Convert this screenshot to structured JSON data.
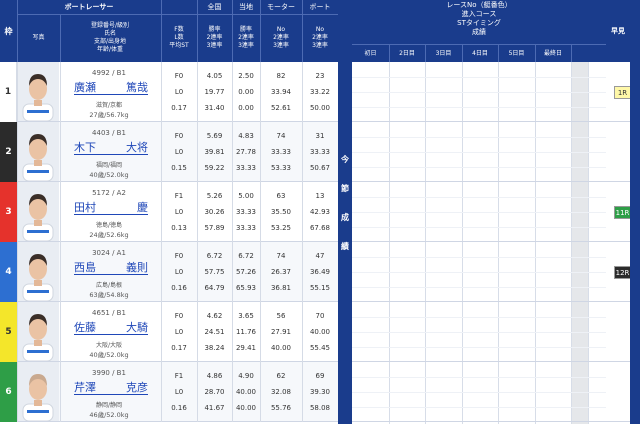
{
  "header": {
    "waku": "枠",
    "boat_racer": "ボートレーサー",
    "photo": "写真",
    "racer_info": [
      "登録番号/級別",
      "氏名",
      "支部/出身地",
      "年齢/体重"
    ],
    "f_l_st": [
      "F数",
      "L数",
      "平均ST"
    ],
    "nationwide": "全国",
    "local": "当地",
    "motor": "モーター",
    "boat": "ボート",
    "rate_labels": [
      "勝率",
      "2連率",
      "3連率"
    ],
    "no_labels": [
      "No",
      "2連率",
      "3連率"
    ],
    "race_info": [
      "レースNo（艇番色）",
      "進入コース",
      "STタイミング",
      "成績"
    ],
    "days": [
      "初日",
      "2日目",
      "3日目",
      "4日目",
      "5日目",
      "最終日"
    ],
    "tenji": "早見",
    "konsetsu": [
      "今",
      "節",
      "成",
      "績"
    ]
  },
  "colors": {
    "header_bg": "#1a3c8c",
    "name_link": "#1f47b8",
    "waku": [
      "#ffffff",
      "#2b2b2b",
      "#e5322c",
      "#2d6fd1",
      "#f4e62a",
      "#2e9e47"
    ],
    "waku_text": [
      "#333333",
      "#ffffff",
      "#ffffff",
      "#ffffff",
      "#333333",
      "#ffffff"
    ]
  },
  "racers": [
    {
      "reg": "4992 / B1",
      "name_sei": "廣瀬",
      "name_mei": "篤哉",
      "org": "滋賀/京都",
      "age": "27歳/56.7kg",
      "fl": [
        "F0",
        "L0",
        "0.17"
      ],
      "nat": [
        "4.05",
        "19.77",
        "31.40"
      ],
      "loc": [
        "2.50",
        "0.00",
        "0.00"
      ],
      "motor": [
        "82",
        "33.94",
        "52.61"
      ],
      "boat": [
        "23",
        "33.22",
        "50.00"
      ],
      "tenji": "1R"
    },
    {
      "reg": "4403 / B1",
      "name_sei": "木下",
      "name_mei": "大将",
      "org": "福岡/福岡",
      "age": "40歳/52.0kg",
      "fl": [
        "F0",
        "L0",
        "0.15"
      ],
      "nat": [
        "5.69",
        "39.81",
        "59.22"
      ],
      "loc": [
        "4.83",
        "27.78",
        "33.33"
      ],
      "motor": [
        "74",
        "33.33",
        "53.33"
      ],
      "boat": [
        "31",
        "33.33",
        "50.67"
      ],
      "tenji": ""
    },
    {
      "reg": "5172 / A2",
      "name_sei": "田村",
      "name_mei": "慶",
      "org": "徳島/徳島",
      "age": "24歳/52.6kg",
      "fl": [
        "F1",
        "L0",
        "0.13"
      ],
      "nat": [
        "5.26",
        "30.26",
        "57.89"
      ],
      "loc": [
        "5.00",
        "33.33",
        "33.33"
      ],
      "motor": [
        "63",
        "35.50",
        "53.25"
      ],
      "boat": [
        "13",
        "42.93",
        "67.68"
      ],
      "tenji": "11R"
    },
    {
      "reg": "3024 / A1",
      "name_sei": "西島",
      "name_mei": "義則",
      "org": "広島/島根",
      "age": "63歳/54.8kg",
      "fl": [
        "F0",
        "L0",
        "0.16"
      ],
      "nat": [
        "6.72",
        "57.75",
        "64.79"
      ],
      "loc": [
        "6.72",
        "57.26",
        "65.93"
      ],
      "motor": [
        "74",
        "26.37",
        "36.81"
      ],
      "boat": [
        "47",
        "36.49",
        "55.15"
      ],
      "tenji": "12R"
    },
    {
      "reg": "4651 / B1",
      "name_sei": "佐藤",
      "name_mei": "大騎",
      "org": "大阪/大阪",
      "age": "40歳/52.0kg",
      "fl": [
        "F0",
        "L0",
        "0.17"
      ],
      "nat": [
        "4.62",
        "24.51",
        "38.24"
      ],
      "loc": [
        "3.65",
        "11.76",
        "29.41"
      ],
      "motor": [
        "56",
        "27.91",
        "40.00"
      ],
      "boat": [
        "70",
        "40.00",
        "55.45"
      ],
      "tenji": ""
    },
    {
      "reg": "3990 / B1",
      "name_sei": "芹澤",
      "name_mei": "克彦",
      "org": "静岡/静岡",
      "age": "46歳/52.0kg",
      "fl": [
        "F1",
        "L0",
        "0.16"
      ],
      "nat": [
        "4.86",
        "28.70",
        "41.67"
      ],
      "loc": [
        "4.90",
        "40.00",
        "40.00"
      ],
      "motor": [
        "62",
        "32.08",
        "55.76"
      ],
      "boat": [
        "69",
        "39.30",
        "58.08"
      ],
      "tenji": ""
    }
  ]
}
